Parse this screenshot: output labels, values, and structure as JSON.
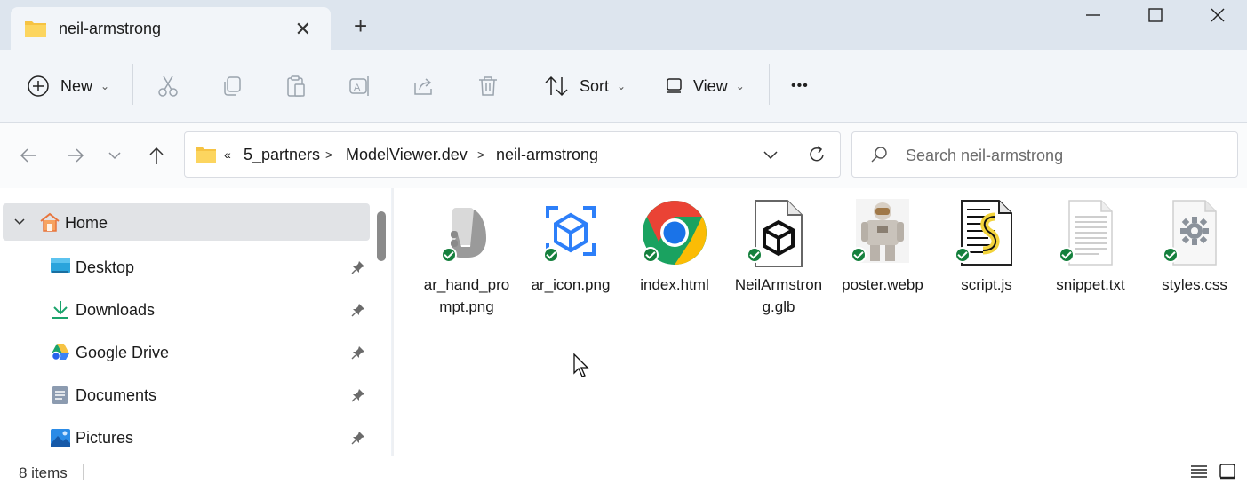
{
  "window": {
    "tab_title": "neil-armstrong",
    "tab_close": "✕",
    "new_tab": "+",
    "minimize": "—",
    "maximize": "☐",
    "close": "✕"
  },
  "toolbar": {
    "new_label": "New",
    "sort_label": "Sort",
    "view_label": "View",
    "more_label": "•••"
  },
  "address": {
    "overflow": "«",
    "crumbs": [
      "5_partners",
      "ModelViewer.dev",
      "neil-armstrong"
    ]
  },
  "search": {
    "placeholder": "Search neil-armstrong"
  },
  "sidebar": {
    "home_label": "Home",
    "items": [
      {
        "label": "Desktop"
      },
      {
        "label": "Downloads"
      },
      {
        "label": "Google Drive"
      },
      {
        "label": "Documents"
      },
      {
        "label": "Pictures"
      }
    ]
  },
  "files": [
    {
      "name": "ar_hand_prompt.png"
    },
    {
      "name": "ar_icon.png"
    },
    {
      "name": "index.html"
    },
    {
      "name": "NeilArmstrong.glb"
    },
    {
      "name": "poster.webp"
    },
    {
      "name": "script.js"
    },
    {
      "name": "snippet.txt"
    },
    {
      "name": "styles.css"
    }
  ],
  "status": {
    "item_count": "8 items"
  },
  "colors": {
    "accent": "#0067c0",
    "sync_badge": "#15803d",
    "folder": "#f6c343"
  }
}
